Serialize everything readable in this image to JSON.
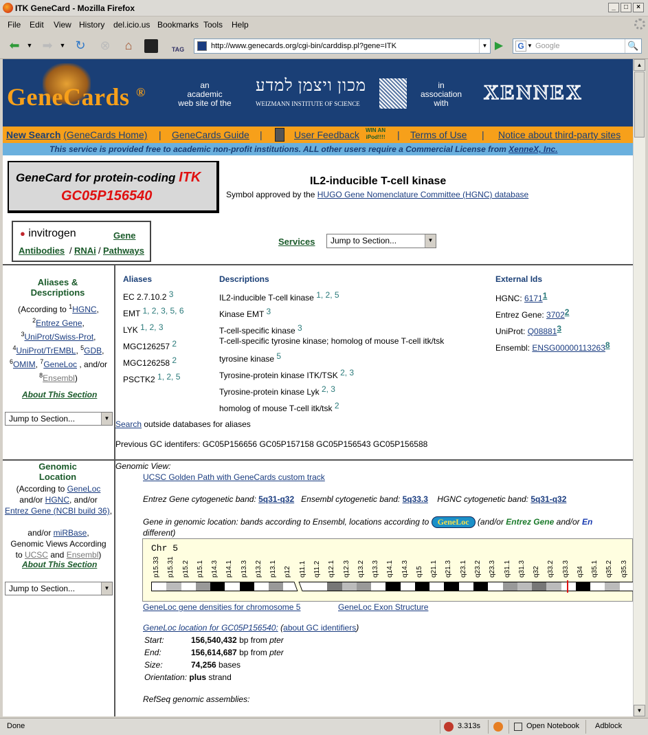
{
  "window": {
    "title": "ITK GeneCard - Mozilla Firefox"
  },
  "menu": [
    "File",
    "Edit",
    "View",
    "History",
    "del.icio.us",
    "Bookmarks",
    "Tools",
    "Help"
  ],
  "nav": {
    "tag_label": "TAG",
    "url": "http://www.genecards.org/cgi-bin/carddisp.pl?gene=ITK",
    "search_placeholder": "Google"
  },
  "banner": {
    "logo": "GeneCards",
    "reg": "®",
    "academic": [
      "an",
      "academic",
      "web site of the"
    ],
    "weizmann_hebrew": "מכון ויצמן למדע",
    "weizmann_english": "WEIZMANN INSTITUTE OF SCIENCE",
    "association": [
      "in",
      "association",
      "with"
    ],
    "xennex": "XENNEX"
  },
  "toplinks": {
    "new_search": "New Search",
    "home": "(GeneCards Home)",
    "guide": "GeneCards Guide",
    "feedback": "User Feedback",
    "win": [
      "WIN AN",
      "iPod!!!!"
    ],
    "terms": "Terms of Use",
    "notice": "Notice about third-party sites",
    "sep": "|"
  },
  "license": {
    "text": "This service is provided free to academic non-profit institutions. ALL other users require a Commercial License from ",
    "link": "XenneX, Inc."
  },
  "genecard": {
    "line1": "GeneCard for protein-coding ",
    "symbol": "ITK",
    "id": "GC05P156540"
  },
  "gene": {
    "name": "IL2-inducible T-cell kinase",
    "approved": "Symbol approved by the ",
    "hgnc_link": "HUGO Gene Nomenclature Committee (HGNC) database"
  },
  "invitrogen": {
    "brand": "invitrogen",
    "gene": "Gene",
    "antibodies": "Antibodies",
    "rnai": "RNAi",
    "pathways": "Pathways",
    "slash": "/"
  },
  "services": {
    "label": "Services",
    "select": "Jump to Section..."
  },
  "aliases_side": {
    "title1": "Aliases &",
    "title2": "Descriptions",
    "according": "(According to ",
    "s1": "1",
    "hgnc": "HGNC",
    "s2": "2",
    "entrez": "Entrez Gene",
    "s3": "3",
    "uniprot": "UniProt/Swiss-Prot",
    "s4": "4",
    "trembl": "UniProt/TrEMBL",
    "s5": "5",
    "gdb": "GDB",
    "s6": "6",
    "omim": "OMIM",
    "s7": "7",
    "geneloc": "GeneLoc",
    "andor": " , and/or",
    "s8": "8",
    "ensembl": "Ensembl",
    "close": ")",
    "about": "About This Section",
    "select": "Jump to Section..."
  },
  "aliases": {
    "header": "Aliases",
    "items": [
      {
        "name": "EC 2.7.10.2",
        "refs": "3"
      },
      {
        "name": "EMT",
        "refs": "1, 2, 3, 5, 6"
      },
      {
        "name": "LYK",
        "refs": "1, 2, 3"
      },
      {
        "name": "MGC126257",
        "refs": "2"
      },
      {
        "name": "MGC126258",
        "refs": "2"
      },
      {
        "name": "PSCTK2",
        "refs": "1, 2, 5"
      }
    ]
  },
  "descriptions": {
    "header": "Descriptions",
    "items": [
      {
        "name": "IL2-inducible T-cell kinase",
        "refs": "1, 2, 5"
      },
      {
        "name": "Kinase EMT",
        "refs": "3"
      },
      {
        "name": "T-cell-specific kinase",
        "refs": "3"
      },
      {
        "name": "T-cell-specific tyrosine kinase; homolog of mouse T-cell itk/tsk",
        "refs": ""
      },
      {
        "name": "tyrosine kinase",
        "refs": "5"
      },
      {
        "name": "Tyrosine-protein kinase ITK/TSK",
        "refs": "2, 3"
      },
      {
        "name": "Tyrosine-protein kinase Lyk",
        "refs": "2, 3"
      },
      {
        "name": "homolog of mouse T-cell itk/tsk",
        "refs": "2"
      }
    ]
  },
  "external": {
    "header": "External Ids",
    "items": [
      {
        "label": "HGNC: ",
        "id": "6171",
        "ref": "1"
      },
      {
        "label": "Entrez Gene: ",
        "id": "3702",
        "ref": "2"
      },
      {
        "label": "UniProt: ",
        "id": "Q08881",
        "ref": "3"
      },
      {
        "label": "Ensembl: ",
        "id": "ENSG00000113263",
        "ref": "8"
      }
    ]
  },
  "search_outside": {
    "link": "Search",
    "text": " outside databases for aliases"
  },
  "previous": "Previous GC identifers: GC05P156656 GC05P157158 GC05P156543 GC05P156588",
  "genomic_side": {
    "title1": "Genomic",
    "title2": "Location",
    "according": "(According to ",
    "geneloc": "GeneLoc",
    "andor1": "and/or ",
    "hgnc": "HGNC",
    "andor2": ", and/or",
    "entrez": "Entrez Gene (NCBI build 36)",
    "comma": ",",
    "andor3": "and/or ",
    "mirbase": "miRBase",
    "comma2": ",",
    "views": "Genomic Views According",
    "to": "to ",
    "ucsc": "UCSC",
    "and": " and ",
    "ensembl": "Ensembl",
    "close": ")",
    "about": "About This Section",
    "select": "Jump to Section..."
  },
  "genomic": {
    "view": "Genomic View:",
    "ucsc_link": "UCSC Golden Path with GeneCards custom track",
    "entrez_band_label": "Entrez Gene cytogenetic band: ",
    "entrez_band": "5q31-q32",
    "ensembl_band_label": "Ensembl cytogenetic band: ",
    "ensembl_band": "5q33.3",
    "hgnc_band_label": "HGNC cytogenetic band: ",
    "hgnc_band": "5q31-q32",
    "gene_in_location": "Gene in genomic location: bands according to Ensembl, locations according to ",
    "geneloc_btn": "GeneLoc",
    "andor_entrez": "(and/or ",
    "entrez_gene": "Entrez Gene",
    "andor2": " and/or ",
    "en": "En",
    "different": "different)",
    "chr_label": "Chr 5",
    "bands": [
      "p15.33",
      "p15.31",
      "p15.2",
      "p15.1",
      "p14.3",
      "p14.1",
      "p13.3",
      "p13.2",
      "p13.1",
      "p12",
      "q11.1",
      "q11.2",
      "q12.1",
      "q12.3",
      "q13.2",
      "q13.3",
      "q14.1",
      "q14.3",
      "q15",
      "q21.1",
      "q21.3",
      "q23.1",
      "q23.2",
      "q23.3",
      "q31.1",
      "q31.3",
      "q32",
      "q33.2",
      "q33.3",
      "q34",
      "q35.1",
      "q35.2",
      "q35.3"
    ],
    "density_link": "GeneLoc gene densities for chromosome 5",
    "exon_link": "GeneLoc Exon Structure",
    "location_link": "GeneLoc location for GC05P156540:",
    "about_gc": "about GC identifiers",
    "start_label": "Start:",
    "start": "156,540,432",
    "start_unit": " bp from ",
    "pter": "pter",
    "end_label": "End:",
    "end": "156,614,687",
    "size_label": "Size:",
    "size": "74,256",
    "size_unit": " bases",
    "orient_label": "Orientation:",
    "orient": "plus",
    "orient_unit": " strand",
    "refseq": "RefSeq genomic assemblies:"
  },
  "status": {
    "text": "Done",
    "time": "3.313s",
    "notebook": "Open Notebook",
    "adblock": "Adblock"
  }
}
